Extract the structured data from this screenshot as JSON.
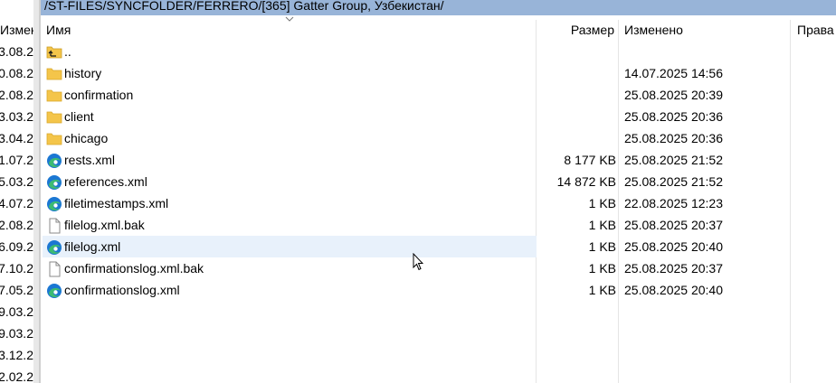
{
  "path": "/ST-FILES/SYNCFOLDER/FERRERO/[365] Gatter Group, Узбекистан/",
  "columns": {
    "name": "Имя",
    "size": "Размер",
    "modified": "Изменено",
    "rights": "Права"
  },
  "left_panel": {
    "header": "Измене",
    "rows": [
      "3.08.2",
      "0.08.2",
      "2.08.2",
      "3.03.2",
      "3.04.2",
      "1.07.2",
      "5.03.2",
      "4.07.2",
      "2.08.2",
      "6.09.2",
      "7.10.2",
      "7.05.2",
      "9.03.2",
      "9.03.2",
      "3.12.2",
      "2.02.2"
    ]
  },
  "files": [
    {
      "name": "..",
      "size": "",
      "modified": "",
      "icon": "parent-dir-icon"
    },
    {
      "name": "history",
      "size": "",
      "modified": "14.07.2025 14:56",
      "icon": "folder-icon"
    },
    {
      "name": "confirmation",
      "size": "",
      "modified": "25.08.2025 20:39",
      "icon": "folder-icon"
    },
    {
      "name": "client",
      "size": "",
      "modified": "25.08.2025 20:36",
      "icon": "folder-icon"
    },
    {
      "name": "chicago",
      "size": "",
      "modified": "25.08.2025 20:36",
      "icon": "folder-icon"
    },
    {
      "name": "rests.xml",
      "size": "8 177 KB",
      "modified": "25.08.2025 21:52",
      "icon": "edge-icon"
    },
    {
      "name": "references.xml",
      "size": "14 872 KB",
      "modified": "25.08.2025 21:52",
      "icon": "edge-icon"
    },
    {
      "name": "filetimestamps.xml",
      "size": "1 KB",
      "modified": "22.08.2025 12:23",
      "icon": "edge-icon"
    },
    {
      "name": "filelog.xml.bak",
      "size": "1 KB",
      "modified": "25.08.2025 20:37",
      "icon": "file-icon"
    },
    {
      "name": "filelog.xml",
      "size": "1 KB",
      "modified": "25.08.2025 20:40",
      "icon": "edge-icon"
    },
    {
      "name": "confirmationslog.xml.bak",
      "size": "1 KB",
      "modified": "25.08.2025 20:37",
      "icon": "file-icon"
    },
    {
      "name": "confirmationslog.xml",
      "size": "1 KB",
      "modified": "25.08.2025 20:40",
      "icon": "edge-icon"
    }
  ],
  "colors": {
    "path_bar": "#98b4d8",
    "hover_row": "#e8f1fb",
    "folder": "#f4c54a",
    "edge_blue": "#1b77d3",
    "edge_green": "#3dbb72"
  }
}
